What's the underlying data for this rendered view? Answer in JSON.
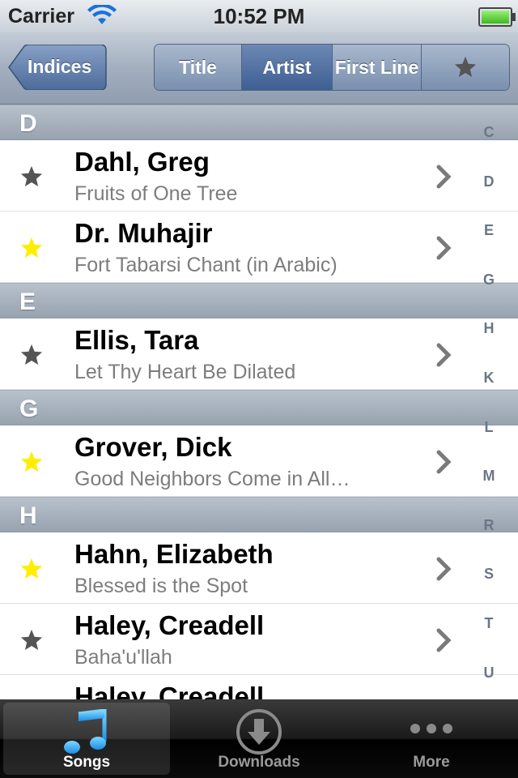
{
  "status": {
    "carrier": "Carrier",
    "time": "10:52 PM"
  },
  "nav": {
    "back_label": "Indices",
    "segments": [
      "Title",
      "Artist",
      "First Line"
    ],
    "selected_segment": "Artist",
    "favorites_icon": "star-icon"
  },
  "sections": [
    {
      "letter": "D",
      "rows": [
        {
          "title": "Dahl, Greg",
          "subtitle": "Fruits of One Tree",
          "favorite": false
        },
        {
          "title": "Dr. Muhajir",
          "subtitle": "Fort Tabarsi Chant (in Arabic)",
          "favorite": true
        }
      ]
    },
    {
      "letter": "E",
      "rows": [
        {
          "title": "Ellis, Tara",
          "subtitle": "Let Thy Heart Be Dilated",
          "favorite": false
        }
      ]
    },
    {
      "letter": "G",
      "rows": [
        {
          "title": "Grover, Dick",
          "subtitle": "Good Neighbors Come in All…",
          "favorite": true
        }
      ]
    },
    {
      "letter": "H",
      "rows": [
        {
          "title": "Hahn, Elizabeth",
          "subtitle": "Blessed is the Spot",
          "favorite": true
        },
        {
          "title": "Haley, Creadell",
          "subtitle": "Baha'u'llah",
          "favorite": false
        },
        {
          "title": "Haley, Creadell",
          "subtitle": "",
          "favorite": false
        }
      ]
    }
  ],
  "index_letters": [
    "C",
    "D",
    "E",
    "G",
    "H",
    "K",
    "L",
    "M",
    "R",
    "S",
    "T",
    "U"
  ],
  "tabs": [
    {
      "label": "Songs",
      "icon": "music-note-icon",
      "selected": true
    },
    {
      "label": "Downloads",
      "icon": "download-icon",
      "selected": false
    },
    {
      "label": "More",
      "icon": "more-icon",
      "selected": false
    }
  ],
  "colors": {
    "favorite_star": "#ffee00",
    "normal_star": "#555555",
    "nav_selected": "#3e5f93"
  }
}
